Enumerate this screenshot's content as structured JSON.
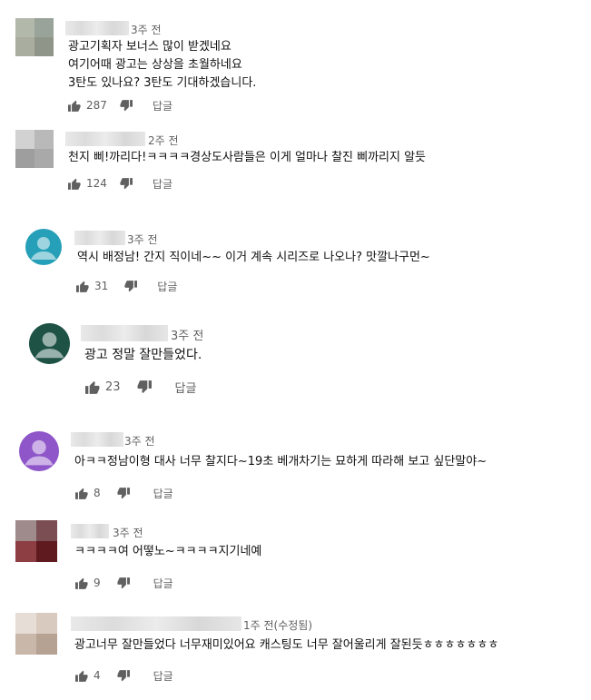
{
  "comments": [
    {
      "time": "3주 전",
      "lines": [
        "광고기획자 보너스 많이 받겠네요",
        "여기어때 광고는 상상을 초월하네요",
        "3탄도 있나요? 3탄도 기대하겠습니다."
      ],
      "likes": "287",
      "reply": "답글"
    },
    {
      "time": "2주 전",
      "lines": [
        "천지 삐!까리다!ㅋㅋㅋㅋ경상도사람들은 이게 얼마나 찰진 삐까리지 알듯"
      ],
      "likes": "124",
      "reply": "답글"
    },
    {
      "time": "3주 전",
      "lines": [
        "역시 배정남! 간지 직이네~~ 이거 계속 시리즈로 나오나? 맛깔나구먼~"
      ],
      "likes": "31",
      "reply": "답글",
      "avatar_color": "#26a0b8"
    },
    {
      "time": "3주 전",
      "lines": [
        "광고 정말 잘만들었다."
      ],
      "likes": "23",
      "reply": "답글",
      "avatar_color": "#1e5245"
    },
    {
      "time": "3주 전",
      "lines": [
        "아ㅋㅋ정남이형 대사 너무 찰지다~19초 베개차기는 묘하게 따라해 보고 싶단말야~"
      ],
      "likes": "8",
      "reply": "답글",
      "avatar_color": "#8e56c9"
    },
    {
      "time": "3주 전",
      "lines": [
        "ㅋㅋㅋㅋ여 어떻노~ㅋㅋㅋㅋ지기네예"
      ],
      "likes": "9",
      "reply": "답글"
    },
    {
      "time": "1주 전(수정됨)",
      "lines": [
        "광고너무 잘만들었다 너무재미있어요 캐스팅도 너무 잘어울리게 잘된듯ㅎㅎㅎㅎㅎㅎㅎ"
      ],
      "likes": "4",
      "reply": "답글"
    }
  ]
}
